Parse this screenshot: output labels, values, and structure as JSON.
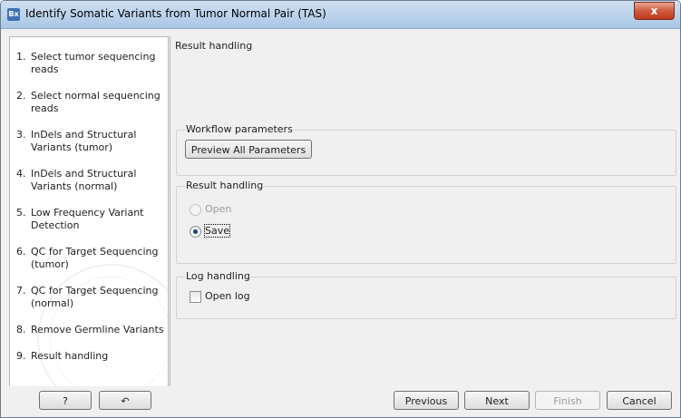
{
  "window": {
    "title": "Identify Somatic Variants from Tumor Normal Pair (TAS)",
    "app_icon_text": "Bx",
    "close_glyph": "x"
  },
  "steps": [
    {
      "num": "1.",
      "label": "Select tumor sequencing reads"
    },
    {
      "num": "2.",
      "label": "Select normal sequencing reads"
    },
    {
      "num": "3.",
      "label": "InDels and Structural Variants (tumor)"
    },
    {
      "num": "4.",
      "label": "InDels and Structural Variants (normal)"
    },
    {
      "num": "5.",
      "label": "Low Frequency Variant Detection"
    },
    {
      "num": "6.",
      "label": "QC for Target Sequencing (tumor)"
    },
    {
      "num": "7.",
      "label": "QC for Target Sequencing (normal)"
    },
    {
      "num": "8.",
      "label": "Remove Germline Variants"
    },
    {
      "num": "9.",
      "label": "Result handling"
    }
  ],
  "content": {
    "title": "Result handling",
    "workflow_parameters": {
      "title": "Workflow parameters",
      "preview_button": "Preview All Parameters"
    },
    "result_handling": {
      "title": "Result handling",
      "options": [
        {
          "label": "Open",
          "enabled": false,
          "selected": false
        },
        {
          "label": "Save",
          "enabled": true,
          "selected": true
        }
      ]
    },
    "log_handling": {
      "title": "Log handling",
      "open_log_label": "Open log",
      "open_log_checked": false
    }
  },
  "footer": {
    "help_label": "?",
    "reset_glyph": "↶",
    "previous": "Previous",
    "next": "Next",
    "finish": "Finish",
    "cancel": "Cancel"
  },
  "colors": {
    "titlebar": "#b9d1ea",
    "close_button": "#d05a3f",
    "selected_radio_dot": "#1f3f84"
  }
}
